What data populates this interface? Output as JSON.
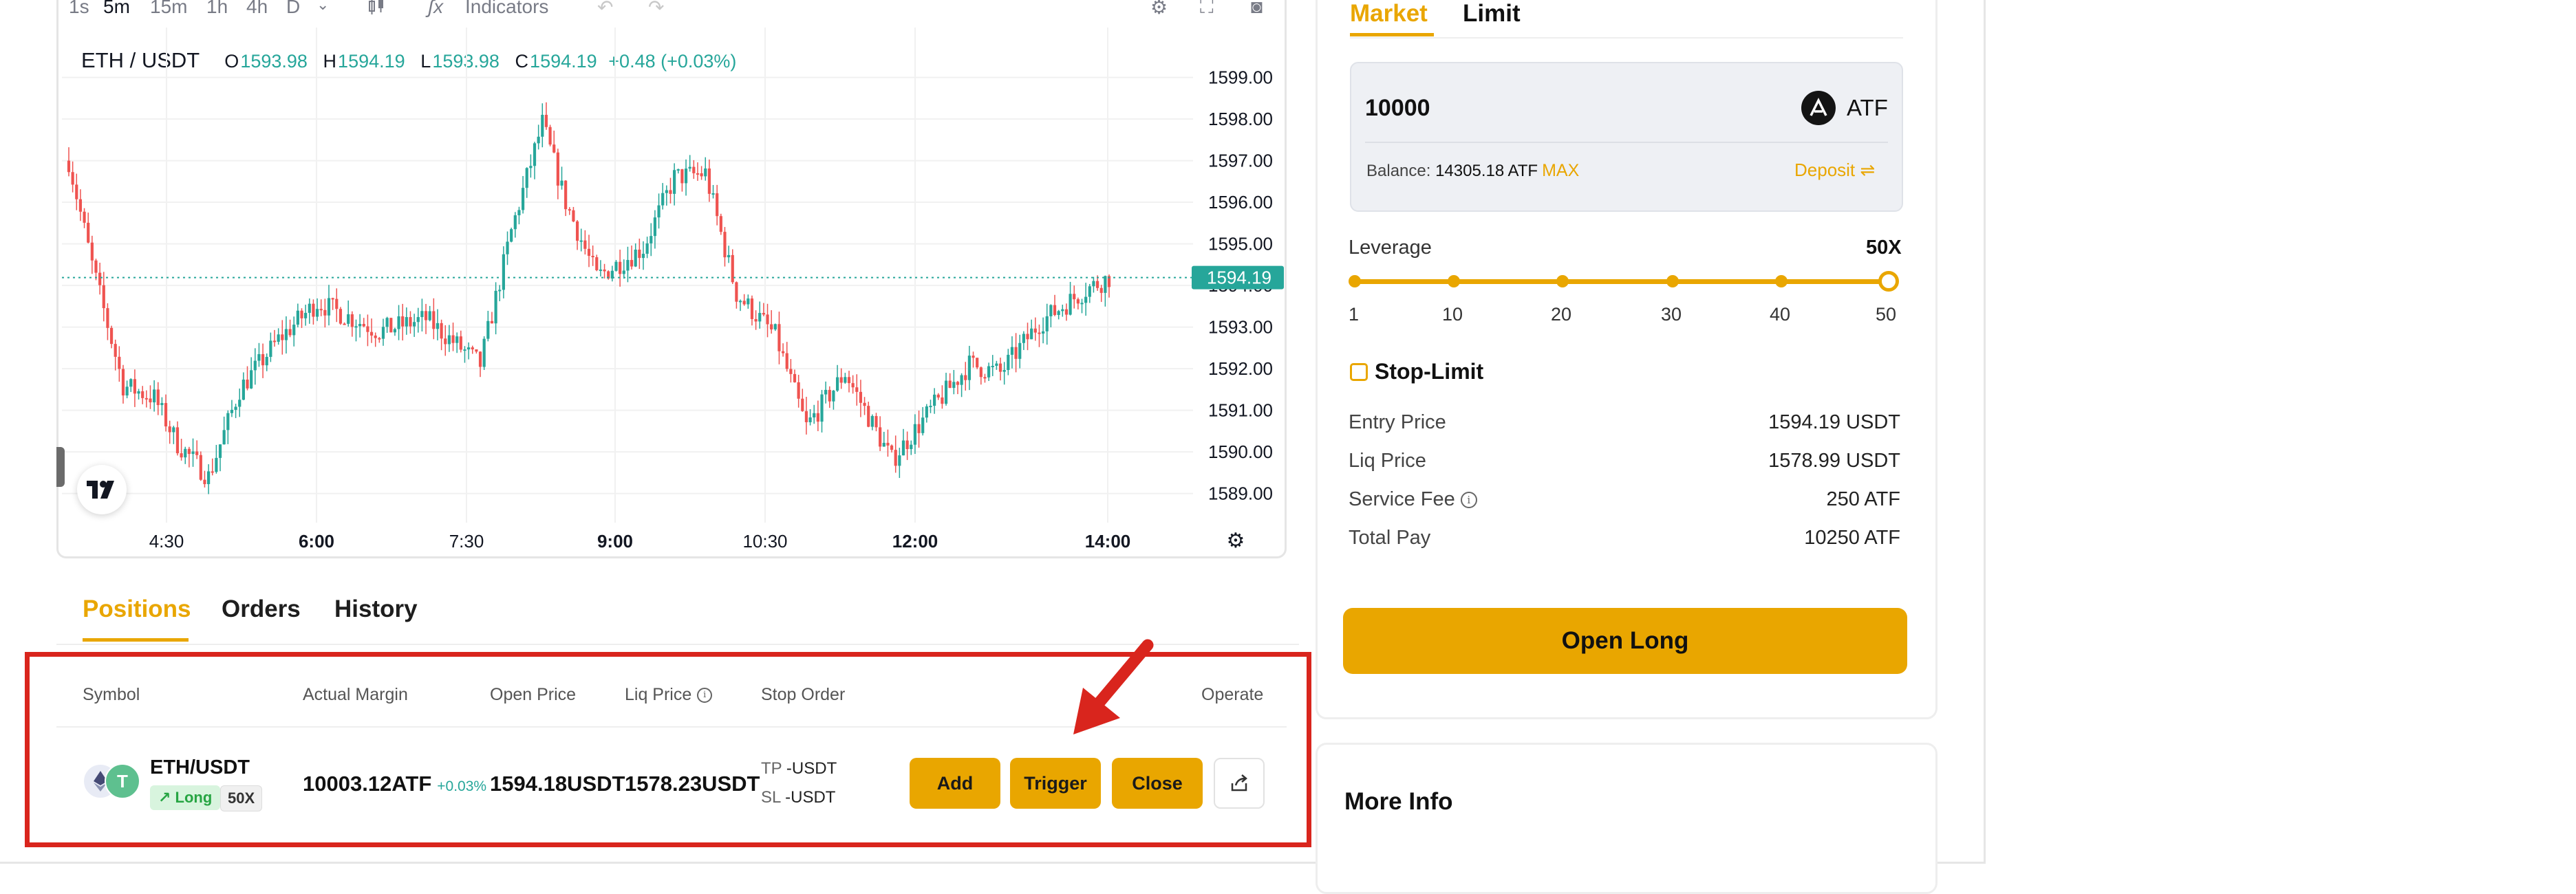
{
  "toolbar": {
    "timeframes": [
      "1s",
      "5m",
      "15m",
      "1h",
      "4h",
      "D"
    ],
    "active_timeframe": "5m",
    "indicators_label": "Indicators"
  },
  "chart": {
    "symbol": "ETH / USDT",
    "ohlc": {
      "o_label": "O",
      "o": "1593.98",
      "h_label": "H",
      "h": "1594.19",
      "l_label": "L",
      "l": "1593.98",
      "c_label": "C",
      "c": "1594.19",
      "change": "+0.48 (+0.03%)"
    },
    "current_price_label": "1594.19",
    "up_color": "#26a69a",
    "down_color": "#ef5350"
  },
  "chart_data": {
    "type": "candlestick",
    "title": "ETH / USDT",
    "interval": "5m",
    "y_ticks": [
      "1599.00",
      "1598.00",
      "1597.00",
      "1596.00",
      "1595.00",
      "1594.00",
      "1593.00",
      "1592.00",
      "1591.00",
      "1590.00",
      "1589.00"
    ],
    "x_ticks": [
      "4:30",
      "6:00",
      "7:30",
      "9:00",
      "10:30",
      "12:00",
      "14:00"
    ],
    "ylim": [
      1588.3,
      1600.2
    ],
    "last_price": 1594.19,
    "grid": true
  },
  "bottom_tabs": [
    {
      "label": "Positions"
    },
    {
      "label": "Orders"
    },
    {
      "label": "History"
    }
  ],
  "positions": {
    "headers": {
      "symbol": "Symbol",
      "margin": "Actual Margin",
      "open_price": "Open Price",
      "liq_price": "Liq Price",
      "stop_order": "Stop Order",
      "operate": "Operate"
    },
    "row": {
      "symbol": "ETH/USDT",
      "side": "Long",
      "leverage": "50X",
      "margin": "10003.12ATF",
      "margin_change": "+0.03%",
      "open_price": "1594.18USDT",
      "liq_price": "1578.23USDT",
      "tp_label": "TP",
      "tp_value": "-USDT",
      "sl_label": "SL",
      "sl_value": "-USDT"
    },
    "buttons": {
      "add": "Add",
      "trigger": "Trigger",
      "close": "Close"
    }
  },
  "trade": {
    "tabs": [
      {
        "label": "Market"
      },
      {
        "label": "Limit"
      }
    ],
    "amount_value": "10000",
    "currency": "ATF",
    "balance_label": "Balance:",
    "balance_value": "14305.18 ATF",
    "max_label": "MAX",
    "deposit_label": "Deposit ⇌",
    "leverage_label": "Leverage",
    "leverage_value": "50X",
    "leverage_marks": [
      "1",
      "10",
      "20",
      "30",
      "40",
      "50"
    ],
    "leverage_fraction": 1.0,
    "stop_limit_label": "Stop-Limit",
    "entry_price_label": "Entry Price",
    "entry_price_value": "1594.19 USDT",
    "liq_price_label": "Liq Price",
    "liq_price_value": "1578.99 USDT",
    "service_fee_label": "Service Fee",
    "service_fee_value": "250 ATF",
    "total_pay_label": "Total Pay",
    "total_pay_value": "10250 ATF",
    "open_long_label": "Open Long"
  },
  "more_info": {
    "title": "More Info"
  },
  "accent_color": "#e9a600",
  "highlight_color": "#d9251d"
}
